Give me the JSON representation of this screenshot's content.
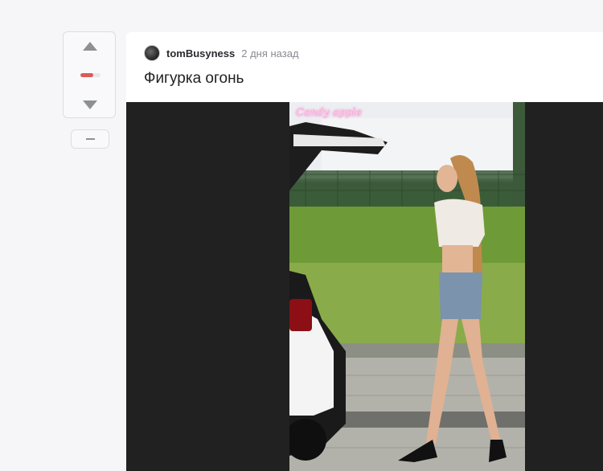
{
  "vote": {
    "rating_fill_fraction": 0.65,
    "rating_color": "#dc5b54",
    "up_icon": "triangle-up-icon",
    "down_icon": "triangle-down-icon",
    "collapse_icon": "minus-icon"
  },
  "post": {
    "author": "tomBusyness",
    "time": "2 дня назад",
    "title": "Фигурка огонь",
    "video": {
      "watermark": "Candy apple"
    }
  }
}
